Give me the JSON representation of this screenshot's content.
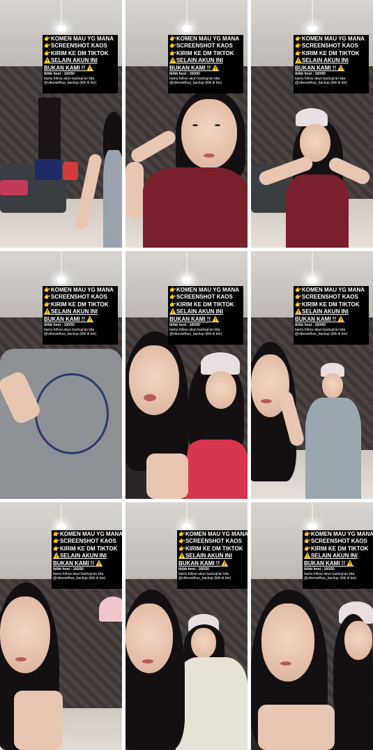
{
  "overlay": {
    "lines": [
      "KOMEN MAU YG MANA",
      "SCREENSHOT KAOS",
      "KIRIM KE DM TIKTOK"
    ],
    "warning_line1": "SELAIN AKUN INI",
    "warning_line2": "BUKAN KAMI !!",
    "host": "tb/bb host : 160/50",
    "follow": "bantu follow akun backup'an kita",
    "account": "@vibeswithus_backup",
    "account_note": "(klik di bio)",
    "hand_icon": "👉",
    "warn_icon": "⚠️"
  },
  "colors": {
    "overlay_bg": "#000000",
    "shirt_maroon": "#7a1f2c",
    "shirt_grey": "#8e9296",
    "cap_pink": "#eadfe0"
  }
}
